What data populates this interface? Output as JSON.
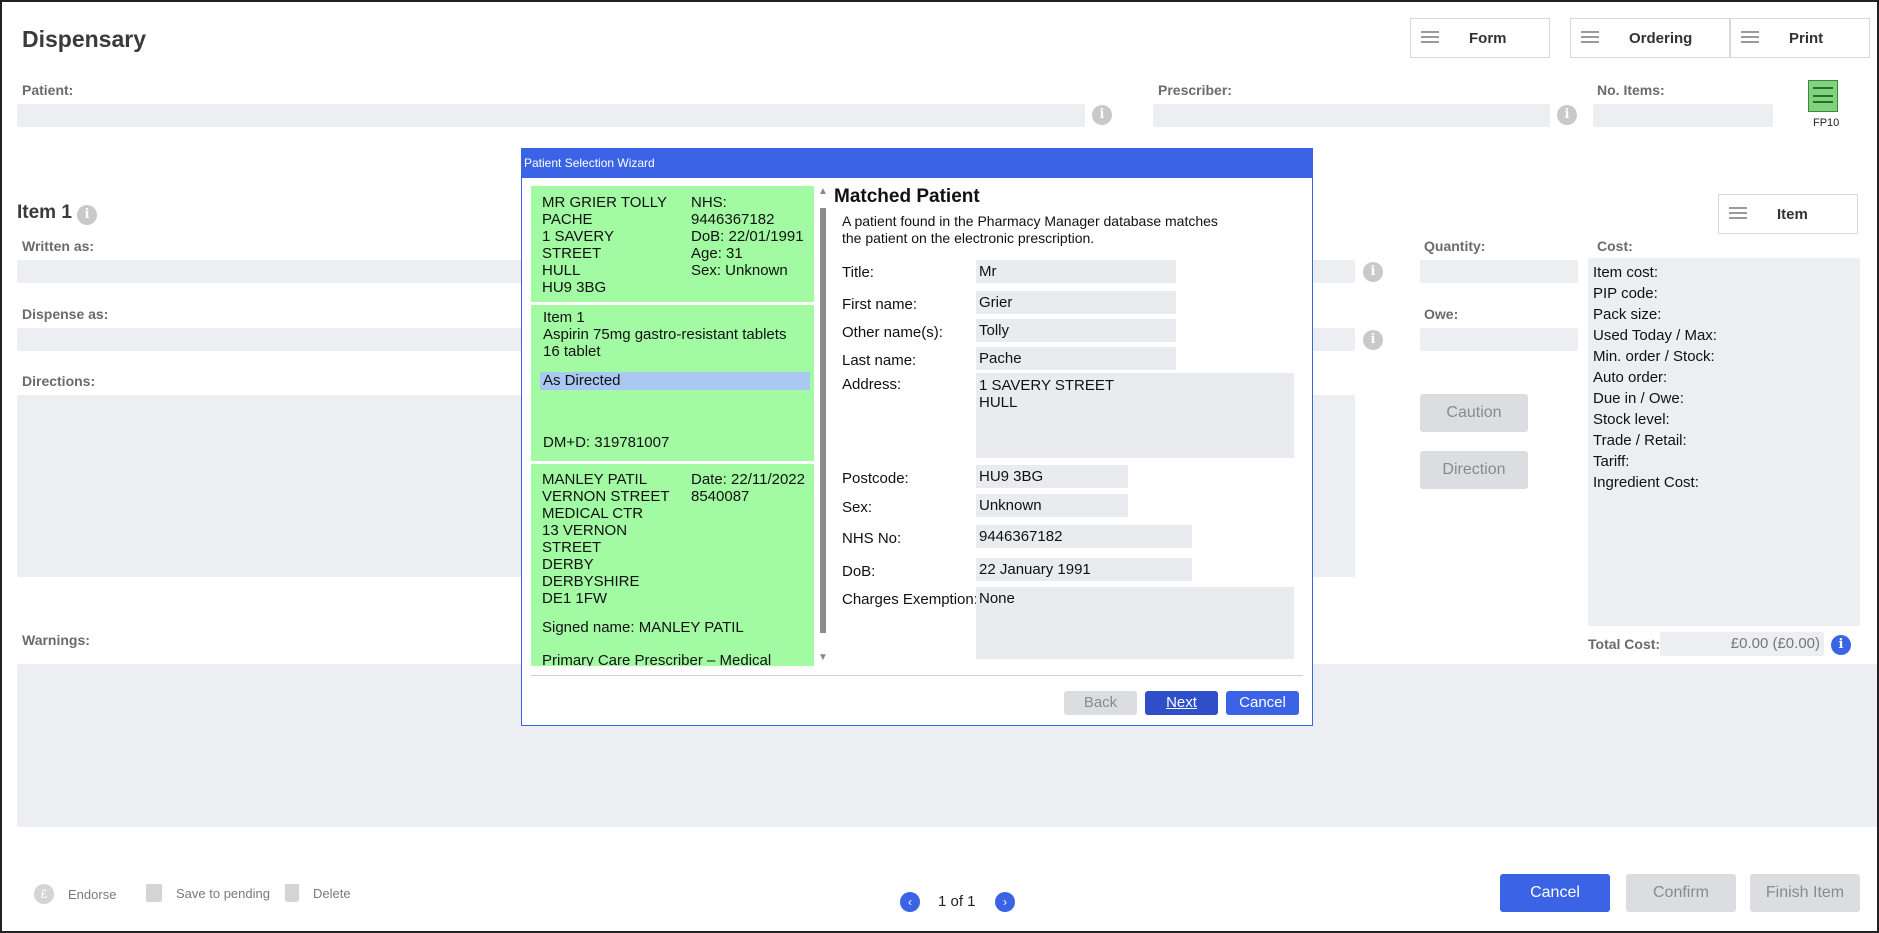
{
  "app": {
    "title": "Dispensary"
  },
  "header_buttons": {
    "form": "Form",
    "ordering": "Ordering",
    "print": "Print"
  },
  "fields": {
    "patient_label": "Patient:",
    "prescriber_label": "Prescriber:",
    "no_items_label": "No. Items:",
    "fp10_label": "FP10",
    "item_title": "Item 1",
    "item_button": "Item",
    "written_as_label": "Written as:",
    "quantity_label": "Quantity:",
    "cost_label": "Cost:",
    "dispense_as_label": "Dispense as:",
    "owe_label": "Owe:",
    "directions_label": "Directions:",
    "warnings_label": "Warnings:",
    "total_cost_label": "Total Cost:",
    "total_cost_value": "£0.00 (£0.00)"
  },
  "side_buttons": {
    "caution": "Caution",
    "direction": "Direction"
  },
  "cost_lines": [
    "Item cost:",
    "PIP code:",
    "Pack size:",
    "Used Today / Max:",
    "Min. order / Stock:",
    "Auto order:",
    "Due in / Owe:",
    "Stock level:",
    "Trade / Retail:",
    "Tariff:",
    "Ingredient Cost:"
  ],
  "bottom": {
    "endorse": "Endorse",
    "save_pending": "Save to pending",
    "delete": "Delete",
    "pager": "1 of 1",
    "cancel": "Cancel",
    "confirm": "Confirm",
    "finish_item": "Finish Item"
  },
  "dialog": {
    "title": "Patient Selection Wizard",
    "patient_card": {
      "left_lines": [
        "MR GRIER TOLLY",
        "PACHE",
        "1 SAVERY",
        "STREET",
        "HULL",
        "HU9 3BG"
      ],
      "right_lines": [
        "NHS:",
        "9446367182",
        "DoB: 22/01/1991",
        "Age: 31",
        "Sex: Unknown"
      ]
    },
    "item_card": {
      "lines": [
        "Item 1",
        "Aspirin 75mg gastro-resistant tablets",
        "16 tablet"
      ],
      "directions": "As Directed",
      "dmd": "DM+D: 319781007"
    },
    "prescriber_card": {
      "left_lines": [
        "MANLEY PATIL",
        "VERNON STREET",
        "MEDICAL CTR",
        "13 VERNON",
        "STREET",
        "DERBY",
        "DERBYSHIRE",
        "DE1 1FW"
      ],
      "right_lines": [
        "Date: 22/11/2022",
        "8540087"
      ],
      "signed": "Signed name: MANLEY PATIL",
      "role": "Primary Care Prescriber – Medical"
    },
    "heading": "Matched Patient",
    "description_lines": [
      "A patient found in the Pharmacy Manager database matches",
      "the patient on the electronic prescription."
    ],
    "rows": {
      "title_label": "Title:",
      "title_value": "Mr",
      "first_label": "First name:",
      "first_value": "Grier",
      "other_label": "Other name(s):",
      "other_value": "Tolly",
      "last_label": "Last name:",
      "last_value": "Pache",
      "address_label": "Address:",
      "address_lines": [
        "1 SAVERY STREET",
        "HULL"
      ],
      "postcode_label": "Postcode:",
      "postcode_value": "HU9 3BG",
      "sex_label": "Sex:",
      "sex_value": "Unknown",
      "nhs_label": "NHS No:",
      "nhs_value": "9446367182",
      "dob_label": "DoB:",
      "dob_value": "22 January 1991",
      "charges_label": "Charges Exemption:",
      "charges_value": "None"
    },
    "buttons": {
      "back": "Back",
      "next": "Next",
      "cancel": "Cancel"
    }
  }
}
